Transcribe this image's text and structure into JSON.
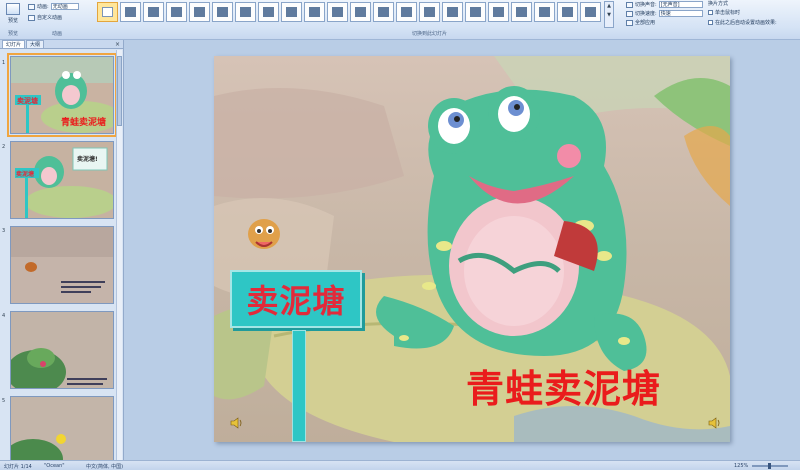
{
  "ribbon": {
    "preview_label": "预览",
    "preview_group": "预览",
    "animation_group": "动画",
    "transition_group": "切换到此幻灯片",
    "anim_effect_label": "动画:",
    "anim_effect_value": "无动画",
    "custom_anim_label": "自定义动画",
    "sound_label": "切换声音:",
    "sound_value": "[无声音]",
    "speed_label": "切换速度:",
    "speed_value": "快速",
    "apply_all_label": "全部应用",
    "advance_title": "换片方式",
    "on_click_label": "单击鼠标时",
    "after_time_label": "在此之后自动设置动画效果:"
  },
  "left_panel": {
    "tabs": [
      "幻灯片",
      "大纲"
    ],
    "close_glyph": "×",
    "slides": [
      {
        "num": "1",
        "sign": "卖泥塘",
        "title": "青蛙卖泥塘"
      },
      {
        "num": "2",
        "sign": "卖泥塘",
        "title": "卖泥塘!"
      },
      {
        "num": "3"
      },
      {
        "num": "4"
      },
      {
        "num": "5"
      }
    ]
  },
  "slide": {
    "sign_text": "卖泥塘",
    "title_text": "青蛙卖泥塘"
  },
  "status": {
    "slide_info": "幻灯片 1/14",
    "theme": "\"Ocean\"",
    "language": "中文(简体, 中国)",
    "zoom": "125%"
  },
  "colors": {
    "sign_fill": "#2ec6c5",
    "title_red": "#ea1c1c",
    "sign_text_red": "#e22a3a"
  },
  "icons": [
    "preview-icon",
    "transition-thumb-icon",
    "sound-icon",
    "close-icon"
  ]
}
